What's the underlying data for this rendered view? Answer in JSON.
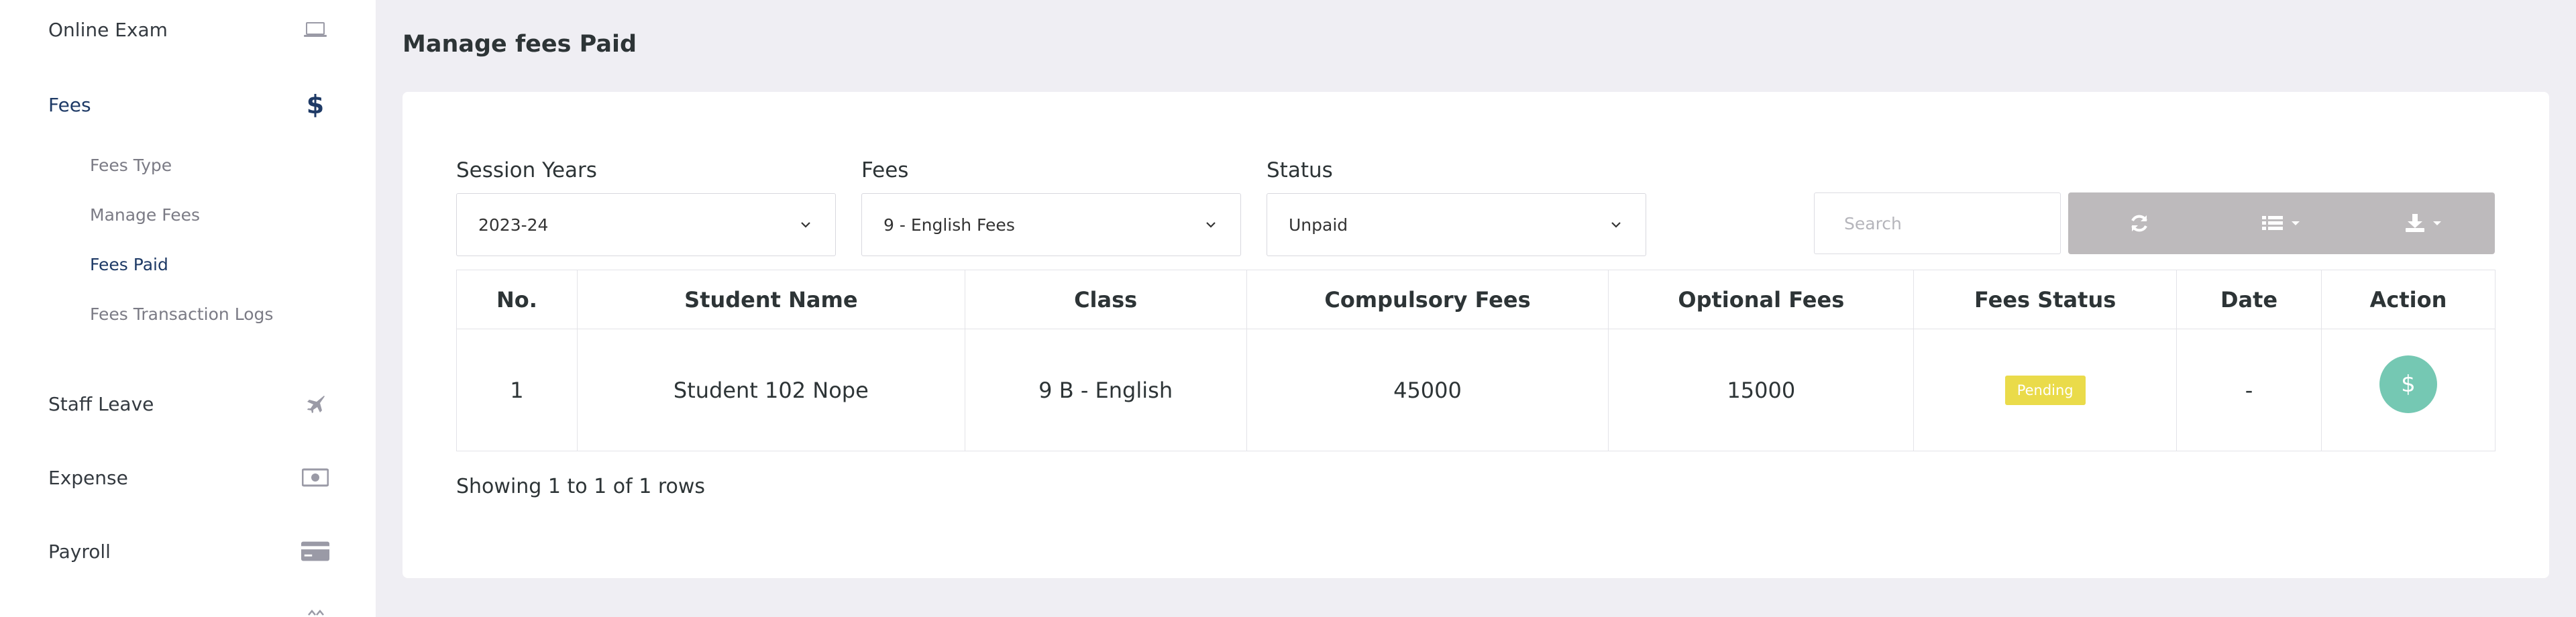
{
  "sidebar": {
    "online_exam": "Online Exam",
    "fees": "Fees",
    "fees_sub": [
      "Fees Type",
      "Manage Fees",
      "Fees Paid",
      "Fees Transaction Logs"
    ],
    "staff_leave": "Staff Leave",
    "expense": "Expense",
    "payroll": "Payroll",
    "icons": {
      "online_exam": "laptop-icon",
      "fees": "dollar-icon",
      "staff_leave": "plane-icon",
      "expense": "money-icon",
      "payroll": "credit-card-icon"
    }
  },
  "page": {
    "title": "Manage fees Paid"
  },
  "filters": {
    "session_label": "Session Years",
    "session_value": "2023-24",
    "fees_label": "Fees",
    "fees_value": "9 - English Fees",
    "status_label": "Status",
    "status_value": "Unpaid"
  },
  "toolbar": {
    "search_placeholder": "Search",
    "icons": [
      "refresh-icon",
      "columns-list-icon",
      "export-download-icon"
    ]
  },
  "table": {
    "headers": [
      "No.",
      "Student Name",
      "Class",
      "Compulsory Fees",
      "Optional Fees",
      "Fees Status",
      "Date",
      "Action"
    ],
    "rows": [
      {
        "no": "1",
        "student_name": "Student 102 Nope",
        "class": "9 B - English",
        "compulsory_fees": "45000",
        "optional_fees": "15000",
        "fees_status": "Pending",
        "date": "-",
        "action_icon": "$"
      }
    ]
  },
  "pagination": {
    "text": "Showing 1 to 1 of 1 rows"
  },
  "colors": {
    "accent": "#1e3a66",
    "pending_badge": "#eadb4a",
    "action_button": "#75c8b3",
    "toolbar_button": "#bdbabc",
    "page_background": "#efeef3"
  }
}
